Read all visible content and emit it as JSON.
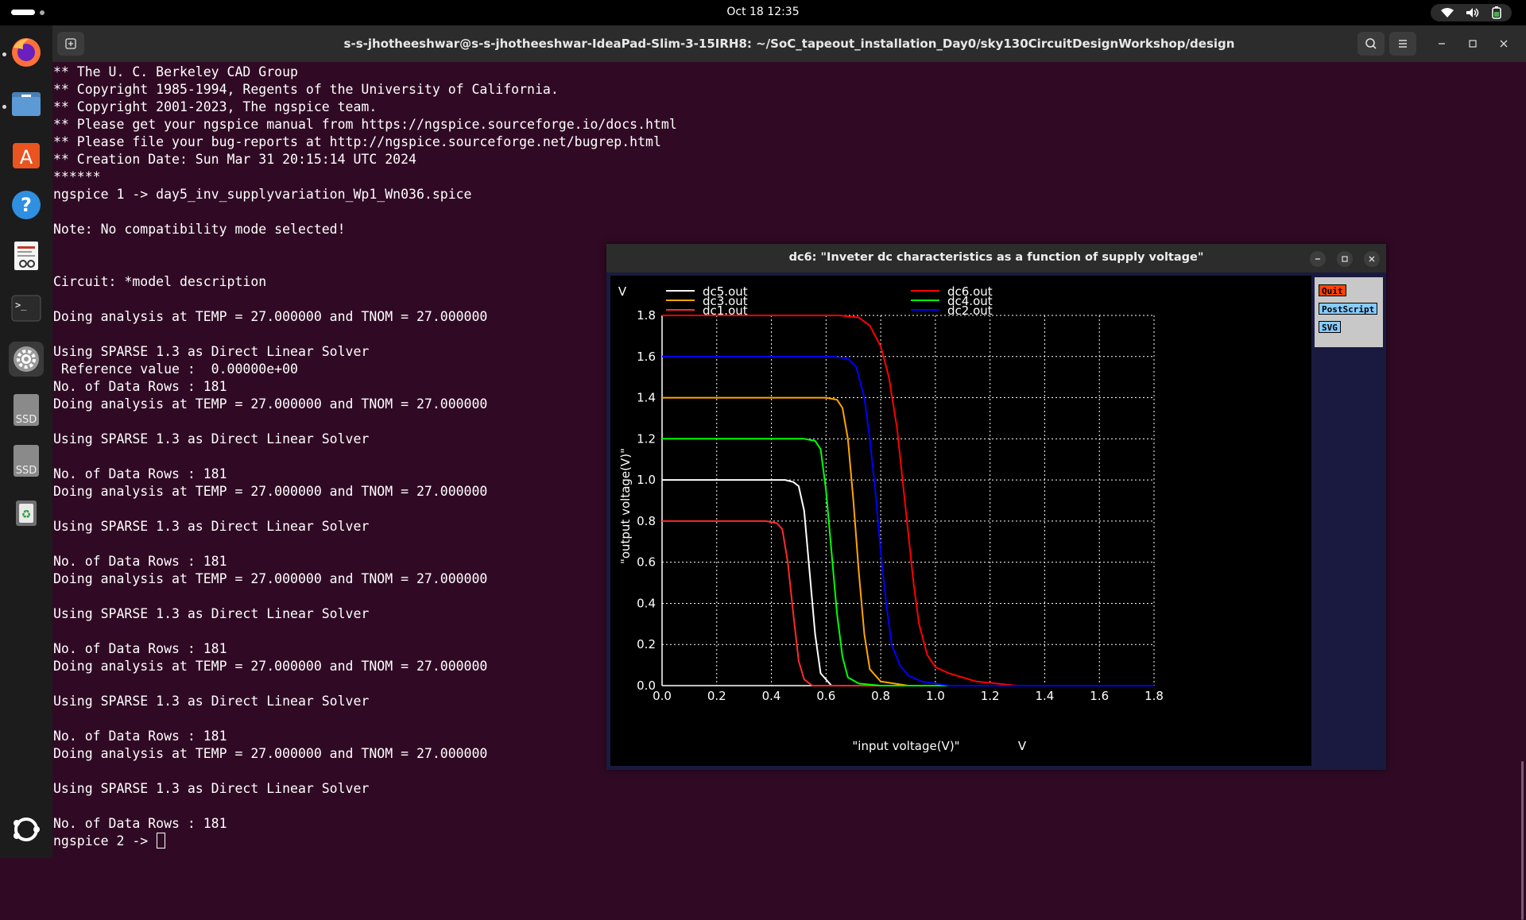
{
  "topbar": {
    "clock": "Oct 18  12:35"
  },
  "window": {
    "title": "s-s-jhotheeshwar@s-s-jhotheeshwar-IdeaPad-Slim-3-15IRH8: ~/SoC_tapeout_installation_Day0/sky130CircuitDesignWorkshop/design"
  },
  "dock": {
    "items": [
      "firefox-icon",
      "files-icon",
      "app-center-icon",
      "help-icon",
      "document-viewer-icon",
      "terminal-icon",
      "settings-icon",
      "ssd-drive-icon",
      "ssd-drive-icon",
      "trash-icon"
    ],
    "ssd_label": "SSD",
    "bottom": "show-apps-icon"
  },
  "terminal": {
    "lines": [
      "** The U. C. Berkeley CAD Group",
      "** Copyright 1985-1994, Regents of the University of California.",
      "** Copyright 2001-2023, The ngspice team.",
      "** Please get your ngspice manual from https://ngspice.sourceforge.io/docs.html",
      "** Please file your bug-reports at http://ngspice.sourceforge.net/bugrep.html",
      "** Creation Date: Sun Mar 31 20:15:14 UTC 2024",
      "******",
      "ngspice 1 -> day5_inv_supplyvariation_Wp1_Wn036.spice",
      "",
      "Note: No compatibility mode selected!",
      "",
      "",
      "Circuit: *model description",
      "",
      "Doing analysis at TEMP = 27.000000 and TNOM = 27.000000",
      "",
      "Using SPARSE 1.3 as Direct Linear Solver",
      " Reference value :  0.00000e+00",
      "No. of Data Rows : 181",
      "Doing analysis at TEMP = 27.000000 and TNOM = 27.000000",
      "",
      "Using SPARSE 1.3 as Direct Linear Solver",
      "",
      "No. of Data Rows : 181",
      "Doing analysis at TEMP = 27.000000 and TNOM = 27.000000",
      "",
      "Using SPARSE 1.3 as Direct Linear Solver",
      "",
      "No. of Data Rows : 181",
      "Doing analysis at TEMP = 27.000000 and TNOM = 27.000000",
      "",
      "Using SPARSE 1.3 as Direct Linear Solver",
      "",
      "No. of Data Rows : 181",
      "Doing analysis at TEMP = 27.000000 and TNOM = 27.000000",
      "",
      "Using SPARSE 1.3 as Direct Linear Solver",
      "",
      "No. of Data Rows : 181",
      "Doing analysis at TEMP = 27.000000 and TNOM = 27.000000",
      "",
      "Using SPARSE 1.3 as Direct Linear Solver",
      "",
      "No. of Data Rows : 181"
    ],
    "prompt": "ngspice 2 -> "
  },
  "plot_window": {
    "title": "dc6: \"Inveter dc characteristics as a function of supply voltage\"",
    "buttons": [
      "Quit",
      "PostScript",
      "SVG"
    ],
    "button_colors": [
      "#ff4400",
      "#88ccff",
      "#88ccff"
    ]
  },
  "chart_data": {
    "type": "line",
    "xlabel": "\"input voltage(V)\"",
    "xunit": "V",
    "ylabel": "\"output voltage(V)\"",
    "yunit": "V",
    "xlim": [
      0.0,
      1.8
    ],
    "ylim": [
      0.0,
      1.8
    ],
    "xticks": [
      "0.0",
      "0.2",
      "0.4",
      "0.6",
      "0.8",
      "1.0",
      "1.2",
      "1.4",
      "1.6",
      "1.8"
    ],
    "yticks": [
      "0.0",
      "0.2",
      "0.4",
      "0.6",
      "0.8",
      "1.0",
      "1.2",
      "1.4",
      "1.6",
      "1.8"
    ],
    "grid": true,
    "legend_placement": "top",
    "series": [
      {
        "name": "dc5.out",
        "color": "#ffffff",
        "vdd": 1.0,
        "x": [
          0,
          0.45,
          0.48,
          0.5,
          0.52,
          0.54,
          0.56,
          0.58,
          0.62,
          1.8
        ],
        "y": [
          1.0,
          1.0,
          0.99,
          0.97,
          0.85,
          0.55,
          0.25,
          0.06,
          0.0,
          0.0
        ]
      },
      {
        "name": "dc3.out",
        "color": "#ffa500",
        "vdd": 1.4,
        "x": [
          0,
          0.6,
          0.64,
          0.66,
          0.68,
          0.7,
          0.72,
          0.74,
          0.76,
          0.8,
          0.9,
          1.8
        ],
        "y": [
          1.4,
          1.4,
          1.39,
          1.35,
          1.2,
          0.9,
          0.55,
          0.25,
          0.08,
          0.02,
          0.0,
          0.0
        ]
      },
      {
        "name": "dc1.out",
        "color": "#ff2a2a",
        "vdd": 0.8,
        "x": [
          0,
          0.38,
          0.42,
          0.44,
          0.46,
          0.48,
          0.5,
          0.52,
          0.55,
          1.8
        ],
        "y": [
          0.8,
          0.8,
          0.79,
          0.76,
          0.6,
          0.35,
          0.12,
          0.03,
          0.0,
          0.0
        ]
      },
      {
        "name": "dc6.out",
        "color": "#ff0000",
        "vdd": 1.8,
        "x": [
          0,
          0.65,
          0.72,
          0.76,
          0.8,
          0.83,
          0.86,
          0.88,
          0.9,
          0.92,
          0.94,
          0.97,
          1.0,
          1.05,
          1.15,
          1.3,
          1.8
        ],
        "y": [
          1.8,
          1.8,
          1.79,
          1.75,
          1.65,
          1.5,
          1.25,
          1.0,
          0.75,
          0.5,
          0.3,
          0.15,
          0.09,
          0.06,
          0.02,
          0.0,
          0.0
        ]
      },
      {
        "name": "dc4.out",
        "color": "#00ff00",
        "vdd": 1.2,
        "x": [
          0,
          0.52,
          0.56,
          0.58,
          0.6,
          0.62,
          0.64,
          0.66,
          0.68,
          0.72,
          0.8,
          1.8
        ],
        "y": [
          1.2,
          1.2,
          1.19,
          1.15,
          0.95,
          0.65,
          0.35,
          0.14,
          0.04,
          0.01,
          0.0,
          0.0
        ]
      },
      {
        "name": "dc2.out",
        "color": "#0000ff",
        "vdd": 1.6,
        "x": [
          0,
          0.62,
          0.68,
          0.71,
          0.74,
          0.76,
          0.78,
          0.8,
          0.82,
          0.84,
          0.87,
          0.9,
          0.95,
          1.05,
          1.8
        ],
        "y": [
          1.6,
          1.6,
          1.59,
          1.55,
          1.4,
          1.2,
          0.95,
          0.65,
          0.4,
          0.2,
          0.1,
          0.05,
          0.02,
          0.0,
          0.0
        ]
      }
    ]
  }
}
